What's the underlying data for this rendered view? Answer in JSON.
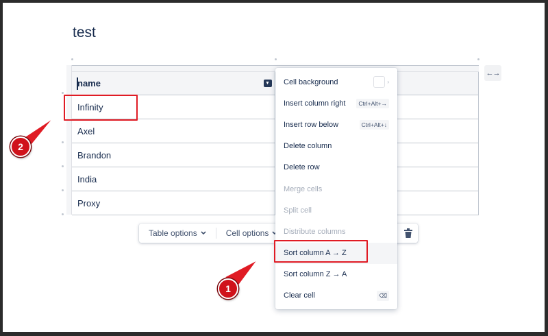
{
  "page": {
    "title": "test"
  },
  "table": {
    "header": "name",
    "rows": [
      "Infinity",
      "Axel",
      "Brandon",
      "India",
      "Proxy"
    ]
  },
  "toolbar": {
    "table_options": "Table options",
    "cell_options": "Cell options"
  },
  "context_menu": {
    "items": [
      {
        "label": "Cell background",
        "shortcut": "",
        "disabled": false
      },
      {
        "label": "Insert column right",
        "shortcut": "Ctrl+Alt+→",
        "disabled": false
      },
      {
        "label": "Insert row below",
        "shortcut": "Ctrl+Alt+↓",
        "disabled": false
      },
      {
        "label": "Delete column",
        "shortcut": "",
        "disabled": false
      },
      {
        "label": "Delete row",
        "shortcut": "",
        "disabled": false
      },
      {
        "label": "Merge cells",
        "shortcut": "",
        "disabled": true
      },
      {
        "label": "Split cell",
        "shortcut": "",
        "disabled": true
      },
      {
        "label": "Distribute columns",
        "shortcut": "",
        "disabled": true
      },
      {
        "label": "Sort column A → Z",
        "shortcut": "",
        "disabled": false
      },
      {
        "label": "Sort column Z → A",
        "shortcut": "",
        "disabled": false
      },
      {
        "label": "Clear cell",
        "shortcut": "⌫",
        "disabled": false
      }
    ]
  },
  "annotations": {
    "step1": "1",
    "step2": "2"
  },
  "colors": {
    "annotation_red": "#e01b24",
    "text": "#172b4d",
    "muted": "#a5adba"
  },
  "icons": {
    "expand": "expand-horizontal-icon",
    "cell_menu": "chevron-down-icon",
    "trash": "trash-icon",
    "submenu": "chevron-right-icon",
    "backspace": "backspace-icon"
  }
}
